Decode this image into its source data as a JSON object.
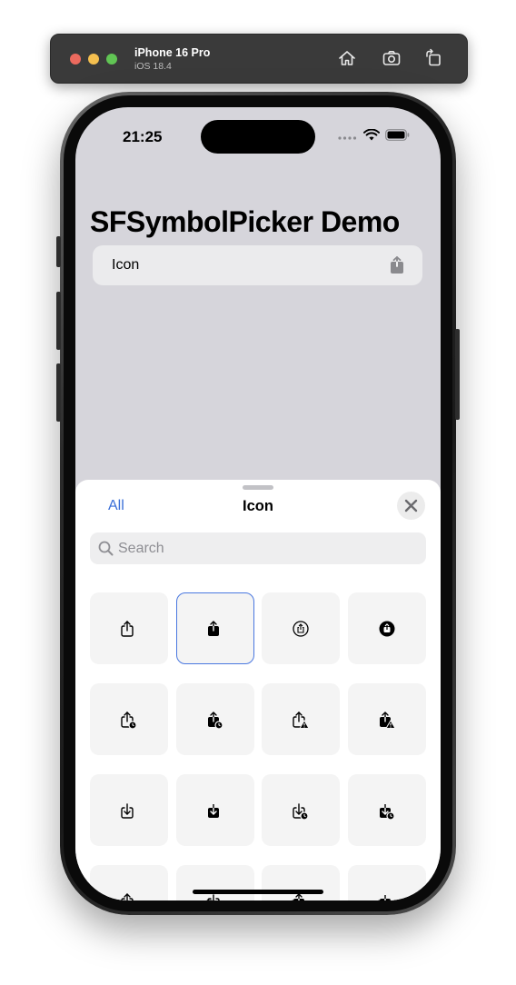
{
  "simulator": {
    "device_name": "iPhone 16 Pro",
    "os_version": "iOS 18.4",
    "buttons": [
      "home",
      "screenshot",
      "rotate"
    ]
  },
  "status_bar": {
    "time": "21:25"
  },
  "app": {
    "title": "SFSymbolPicker Demo",
    "row": {
      "label": "Icon",
      "icon": "square-and-arrow-up-fill-icon"
    }
  },
  "sheet": {
    "left_button": "All",
    "title": "Icon",
    "close_icon": "xmark-icon",
    "search_placeholder": "Search",
    "accent_color": "#3a6fd8",
    "symbols": [
      "square.and.arrow.up",
      "square.and.arrow.up.fill",
      "square.and.arrow.up.circle",
      "square.and.arrow.up.circle.fill",
      "square.and.arrow.up.badge.clock",
      "square.and.arrow.up.badge.clock.fill",
      "square.and.arrow.up.trianglebadge.exclamationmark",
      "square.and.arrow.up.trianglebadge.exclamationmark.fill",
      "square.and.arrow.down",
      "square.and.arrow.down.fill",
      "square.and.arrow.down.badge.clock",
      "square.and.arrow.down.badge.clock.fill",
      "square.and.arrow.up.on.square",
      "square.and.arrow.down.on.square",
      "square.and.arrow.up.on.square.fill",
      "square.and.arrow.down.on.square.fill"
    ],
    "selected_index": 1
  }
}
